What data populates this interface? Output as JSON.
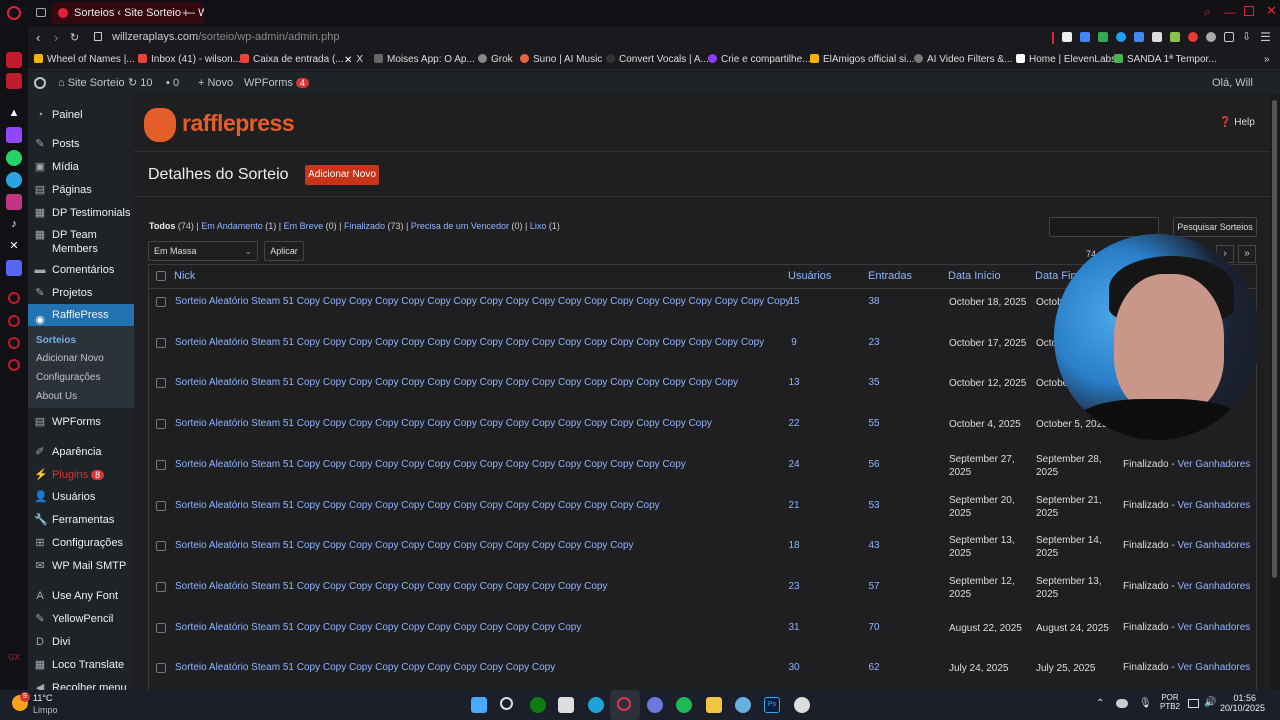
{
  "browser": {
    "tab_title": "Sorteios ‹ Site Sorteio — W",
    "url_host": "willzeraplays.com",
    "url_path": "/sorteio/wp-admin/admin.php",
    "bookmarks": [
      "Wheel of Names |...",
      "Inbox (41) - wilson...",
      "Caixa de entrada (...",
      "X",
      "Moises App: O Ap...",
      "Grok",
      "Suno | AI Music",
      "Convert Vocals | A...",
      "Crie e compartilhe...",
      "ElAmigos official si...",
      "AI Video Filters &...",
      "Home | ElevenLabs",
      "SANDA 1ª Tempor..."
    ]
  },
  "adminbar": {
    "site": "Site Sorteio",
    "updates": "10",
    "comments": "0",
    "new": "Novo",
    "wpforms": "WPForms",
    "wpforms_badge": "4",
    "greeting": "Olá, Will"
  },
  "menu": {
    "items": [
      "Painel",
      "Posts",
      "Mídia",
      "Páginas",
      "DP Testimonials",
      "DP Team Members",
      "Comentários",
      "Projetos",
      "RafflePress",
      "WPForms",
      "Aparência",
      "Plugins",
      "Usuários",
      "Ferramentas",
      "Configurações",
      "WP Mail SMTP",
      "Use Any Font",
      "YellowPencil",
      "Divi",
      "Loco Translate",
      "Recolher menu"
    ],
    "plugins_badge": "8",
    "submenu": [
      "Sorteios",
      "Adicionar Novo",
      "Configurações",
      "About Us"
    ]
  },
  "header": {
    "logo": "rafflepress",
    "help": "Help"
  },
  "page": {
    "title": "Detalhes do Sorteio",
    "add_new": "Adicionar Novo",
    "filters": {
      "todos": "Todos",
      "todos_count": "(74)",
      "andamento": "Em Andamento",
      "andamento_count": "(1)",
      "breve": "Em Breve",
      "breve_count": "(0)",
      "finalizado": "Finalizado",
      "finalizado_count": "(73)",
      "vencedor": "Precisa de um Vencedor",
      "vencedor_count": "(0)",
      "lixo": "Lixo",
      "lixo_count": "(1)"
    },
    "search_button": "Pesquisar Sorteios",
    "bulk_select": "Em Massa",
    "apply": "Aplicar",
    "items_count": "74",
    "pager_next": "›",
    "pager_last": "»"
  },
  "table": {
    "headers": {
      "nick": "Nick",
      "users": "Usuários",
      "entries": "Entradas",
      "start": "Data Início",
      "end": "Data Fim"
    },
    "rows": [
      {
        "title": "Sorteio Aleatório Steam 51 Copy Copy Copy Copy Copy Copy Copy Copy Copy Copy Copy Copy Copy Copy Copy Copy Copy Copy Copy",
        "users": "15",
        "entries": "38",
        "start": "October 18, 2025",
        "end": "Octob",
        "status": "",
        "link": ""
      },
      {
        "title": "Sorteio Aleatório Steam 51 Copy Copy Copy Copy Copy Copy Copy Copy Copy Copy Copy Copy Copy Copy Copy Copy Copy Copy",
        "users": "9",
        "entries": "23",
        "start": "October 17, 2025",
        "end": "Octo",
        "status": "",
        "link": ""
      },
      {
        "title": "Sorteio Aleatório Steam 51 Copy Copy Copy Copy Copy Copy Copy Copy Copy Copy Copy Copy Copy Copy Copy Copy Copy",
        "users": "13",
        "entries": "35",
        "start": "October 12, 2025",
        "end": "October",
        "status": "",
        "link": ""
      },
      {
        "title": "Sorteio Aleatório Steam 51 Copy Copy Copy Copy Copy Copy Copy Copy Copy Copy Copy Copy Copy Copy Copy Copy",
        "users": "22",
        "entries": "55",
        "start": "October 4, 2025",
        "end": "October 5, 2025",
        "status": "",
        "link": "adores"
      },
      {
        "title": "Sorteio Aleatório Steam 51 Copy Copy Copy Copy Copy Copy Copy Copy Copy Copy Copy Copy Copy Copy Copy",
        "users": "24",
        "entries": "56",
        "start": "September 27, 2025",
        "end": "September 28, 2025",
        "status": "Finalizado -",
        "link": "Ver Ganhadores"
      },
      {
        "title": "Sorteio Aleatório Steam 51 Copy Copy Copy Copy Copy Copy Copy Copy Copy Copy Copy Copy Copy Copy",
        "users": "21",
        "entries": "53",
        "start": "September 20, 2025",
        "end": "September 21, 2025",
        "status": "Finalizado -",
        "link": "Ver Ganhadores"
      },
      {
        "title": "Sorteio Aleatório Steam 51 Copy Copy Copy Copy Copy Copy Copy Copy Copy Copy Copy Copy Copy",
        "users": "18",
        "entries": "43",
        "start": "September 13, 2025",
        "end": "September 14, 2025",
        "status": "Finalizado -",
        "link": "Ver Ganhadores"
      },
      {
        "title": "Sorteio Aleatório Steam 51 Copy Copy Copy Copy Copy Copy Copy Copy Copy Copy Copy Copy",
        "users": "23",
        "entries": "57",
        "start": "September 12, 2025",
        "end": "September 13, 2025",
        "status": "Finalizado -",
        "link": "Ver Ganhadores"
      },
      {
        "title": "Sorteio Aleatório Steam 51 Copy Copy Copy Copy Copy Copy Copy Copy Copy Copy Copy",
        "users": "31",
        "entries": "70",
        "start": "August 22, 2025",
        "end": "August 24, 2025",
        "status": "Finalizado -",
        "link": "Ver Ganhadores"
      },
      {
        "title": "Sorteio Aleatório Steam 51 Copy Copy Copy Copy Copy Copy Copy Copy Copy Copy",
        "users": "30",
        "entries": "62",
        "start": "July 24, 2025",
        "end": "July 25, 2025",
        "status": "Finalizado -",
        "link": "Ver Ganhadores"
      }
    ]
  },
  "taskbar": {
    "temp": "11°C",
    "weather": "Limpo",
    "weather_badge": "9",
    "lang": "POR",
    "layout": "PTB2",
    "time": "01:56",
    "date": "20/10/2025"
  },
  "colors": {
    "accent": "#2271b1",
    "link": "#8fb4ff",
    "raffle_orange": "#e35e28",
    "add_btn": "#c7341a",
    "opera_red": "#e0203a"
  }
}
